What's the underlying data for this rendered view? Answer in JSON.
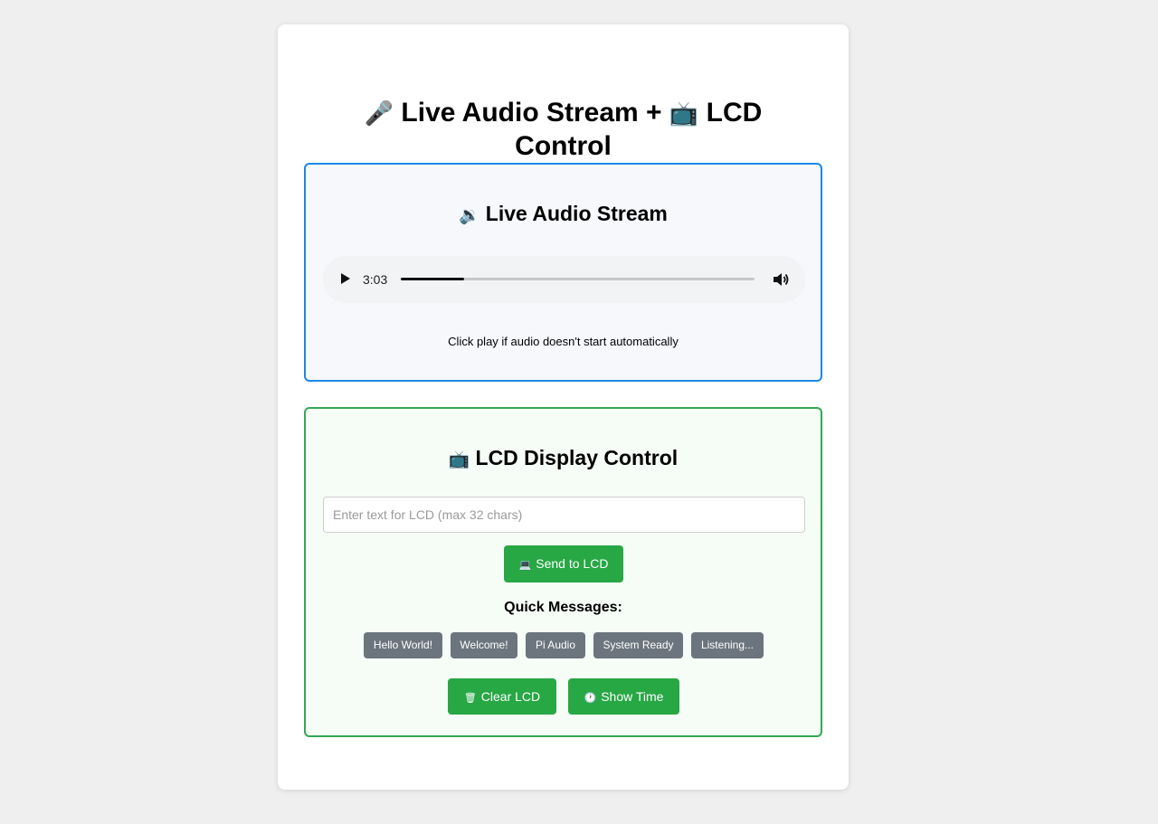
{
  "header": {
    "title_line1": "Live Audio Stream + ",
    "title_line1_end": " LCD",
    "title_line2": "Control",
    "mic_icon": "🎤",
    "tv_icon": "📺"
  },
  "audio_section": {
    "title": "Live Audio Stream",
    "speaker_icon": "🔉",
    "player": {
      "time": "3:03",
      "progress": 0.18
    },
    "hint": "Click play if audio doesn't start automatically"
  },
  "lcd_section": {
    "title": "LCD Display Control",
    "tv_icon": "📺",
    "input": {
      "placeholder": "Enter text for LCD (max 32 chars)",
      "value": ""
    },
    "send_button": {
      "label": "Send to LCD",
      "icon": "💻"
    },
    "quick_label": "Quick Messages:",
    "quick_messages": [
      "Hello World!",
      "Welcome!",
      "Pi Audio",
      "System Ready",
      "Listening..."
    ],
    "clear_button": {
      "label": "Clear LCD",
      "icon": "🗑"
    },
    "time_button": {
      "label": "Show Time",
      "icon": "🕐"
    }
  },
  "colors": {
    "audio_border": "#1e88e5",
    "lcd_border": "#34a853",
    "green_button": "#28a745",
    "gray_button": "#6c757d"
  }
}
